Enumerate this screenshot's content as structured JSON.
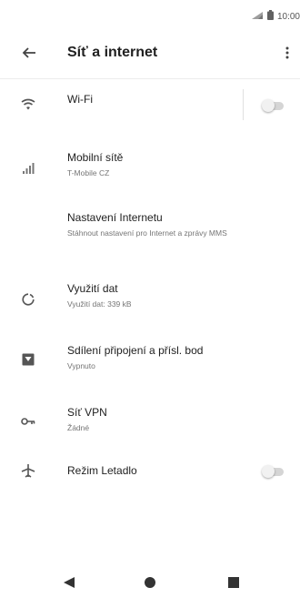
{
  "status_bar": {
    "time": "10:00",
    "icons": [
      "signal-icon",
      "battery-icon"
    ]
  },
  "app_bar": {
    "title": "Síť a internet",
    "back_icon": "arrow-back-icon",
    "menu_icon": "more-vert-icon"
  },
  "items": [
    {
      "title": "Wi-Fi",
      "subtitle": "",
      "icon": "wifi-icon",
      "toggle": false
    },
    {
      "title": "Mobilní sítě",
      "subtitle": "T-Mobile CZ",
      "icon": "cell-signal-icon"
    },
    {
      "title": "Nastavení Internetu",
      "subtitle": "Stáhnout nastavení pro Internet a zprávy MMS",
      "icon": ""
    },
    {
      "title": "Využití dat",
      "subtitle": "Využití dat: 339 kB",
      "icon": "data-usage-icon"
    },
    {
      "title": "Sdílení připojení a přísl. bod",
      "subtitle": "Vypnuto",
      "icon": "hotspot-icon"
    },
    {
      "title": "Síť VPN",
      "subtitle": "Žádné",
      "icon": "vpn-key-icon"
    },
    {
      "title": "Režim Letadlo",
      "subtitle": "",
      "icon": "airplane-icon",
      "toggle": false
    }
  ],
  "nav_bar": {
    "icons": [
      "back-triangle-icon",
      "home-circle-icon",
      "recents-square-icon"
    ]
  },
  "colors": {
    "icon": "#555555",
    "text": "#212121",
    "secondary": "#757575",
    "toggle_track": "#d5d5d5"
  }
}
